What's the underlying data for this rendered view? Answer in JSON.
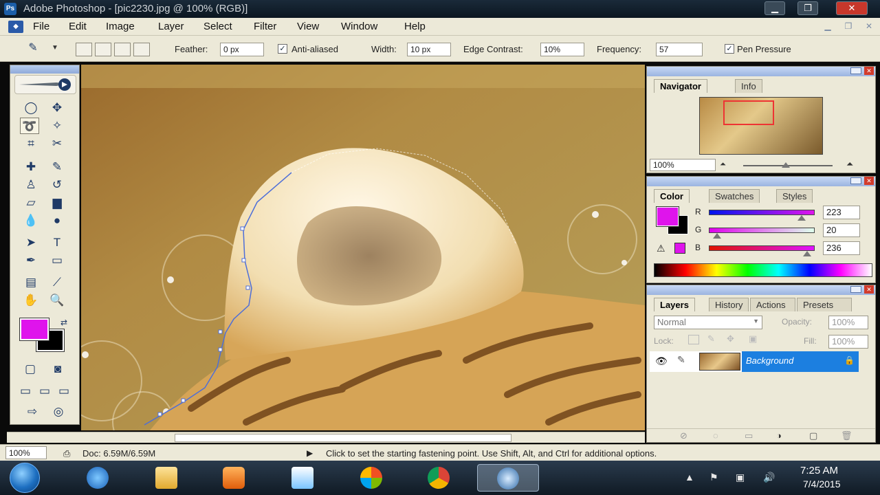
{
  "window": {
    "title": "Adobe Photoshop - [pic2230.jpg @ 100% (RGB)]",
    "app_icon_label": "Ps"
  },
  "menu": [
    "File",
    "Edit",
    "Image",
    "Layer",
    "Select",
    "Filter",
    "View",
    "Window",
    "Help"
  ],
  "options": {
    "feather_label": "Feather:",
    "feather_value": "0 px",
    "antialiased_label": "Anti-aliased",
    "width_label": "Width:",
    "width_value": "10 px",
    "edge_contrast_label": "Edge Contrast:",
    "edge_contrast_value": "10%",
    "frequency_label": "Frequency:",
    "frequency_value": "57",
    "pen_pressure_label": "Pen Pressure"
  },
  "status": {
    "zoom": "100%",
    "doc": "Doc: 6.59M/6.59M",
    "hint": "Click to set the starting fastening point. Use Shift, Alt, and Ctrl for additional options."
  },
  "navigator": {
    "tabs": [
      "Navigator",
      "Info"
    ],
    "zoom": "100%"
  },
  "color_panel": {
    "tabs": [
      "Color",
      "Swatches",
      "Styles"
    ],
    "r_label": "R",
    "g_label": "G",
    "b_label": "B",
    "r": 223,
    "g": 20,
    "b": 236,
    "foreground": "#df14ec",
    "background": "#000000"
  },
  "layers_panel": {
    "tabs": [
      "Layers",
      "History",
      "Actions",
      "Presets"
    ],
    "blend_mode": "Normal",
    "opacity_label": "Opacity:",
    "opacity": "100%",
    "lock_label": "Lock:",
    "fill_label": "Fill:",
    "fill": "100%",
    "layer_name": "Background"
  },
  "taskbar": {
    "time": "7:25 AM",
    "date": "7/4/2015"
  },
  "colors": {
    "accent_selection": "#1c7fe0",
    "panel_bg": "#ece9d8"
  }
}
